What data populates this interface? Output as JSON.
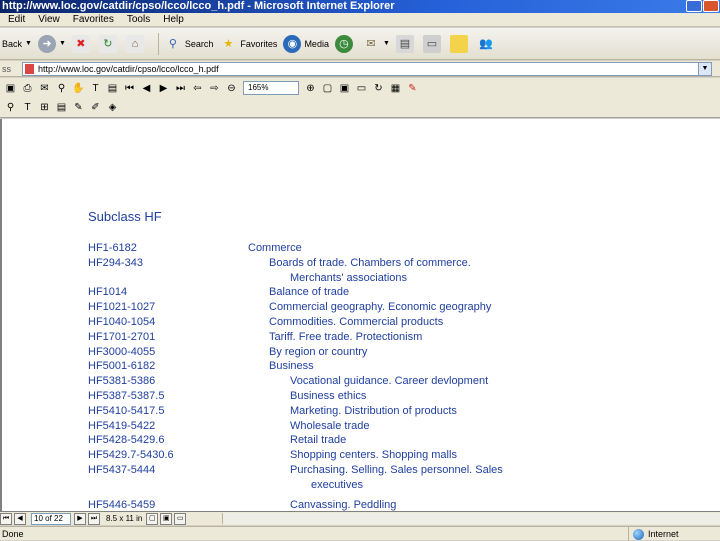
{
  "window": {
    "title": "http://www.loc.gov/catdir/cpso/lcco/lcco_h.pdf - Microsoft Internet Explorer"
  },
  "menu": {
    "items": [
      "Edit",
      "View",
      "Favorites",
      "Tools",
      "Help"
    ]
  },
  "toolbar": {
    "back_label": "Back",
    "search_label": "Search",
    "favorites_label": "Favorites",
    "media_label": "Media"
  },
  "address": {
    "label": "Address",
    "url": "http://www.loc.gov/catdir/cpso/lcco/lcco_h.pdf"
  },
  "pdf_toolbar": {
    "zoom": "165%"
  },
  "document": {
    "title": "Subclass HF",
    "rows": [
      {
        "code": "HF1-6182",
        "desc": "Commerce",
        "indent": 0
      },
      {
        "code": "HF294-343",
        "desc": "Boards of trade.  Chambers of commerce.",
        "indent": 1
      },
      {
        "code": "",
        "desc": "Merchants' associations",
        "indent": 2
      },
      {
        "code": "HF1014",
        "desc": "Balance of trade",
        "indent": 1
      },
      {
        "code": "HF1021-1027",
        "desc": "Commercial geography.  Economic geography",
        "indent": 1
      },
      {
        "code": "HF1040-1054",
        "desc": "Commodities.  Commercial products",
        "indent": 1
      },
      {
        "code": "HF1701-2701",
        "desc": "Tariff.  Free trade.  Protectionism",
        "indent": 1
      },
      {
        "code": "HF3000-4055",
        "desc": "By region or country",
        "indent": 1
      },
      {
        "code": "HF5001-6182",
        "desc": "Business",
        "indent": 1
      },
      {
        "code": "HF5381-5386",
        "desc": "Vocational guidance.  Career devlopment",
        "indent": 2
      },
      {
        "code": "HF5387-5387.5",
        "desc": "Business ethics",
        "indent": 2
      },
      {
        "code": "HF5410-5417.5",
        "desc": "Marketing.  Distribution of products",
        "indent": 2
      },
      {
        "code": "HF5419-5422",
        "desc": "Wholesale trade",
        "indent": 2
      },
      {
        "code": "HF5428-5429.6",
        "desc": "Retail trade",
        "indent": 2
      },
      {
        "code": "HF5429.7-5430.6",
        "desc": "Shopping centers.  Shopping malls",
        "indent": 2
      },
      {
        "code": "HF5437-5444",
        "desc": "Purchasing.  Selling.  Sales personnel.  Sales",
        "indent": 2
      },
      {
        "code": "",
        "desc": "executives",
        "indent": 3
      },
      {
        "code": "HF5446-5459",
        "desc": "Canvassing.  Peddling",
        "indent": 2
      }
    ]
  },
  "pdf_status": {
    "page": "10 of 22",
    "size": "8.5 x 11 in"
  },
  "status": {
    "left": "Done",
    "zone": "Internet"
  }
}
